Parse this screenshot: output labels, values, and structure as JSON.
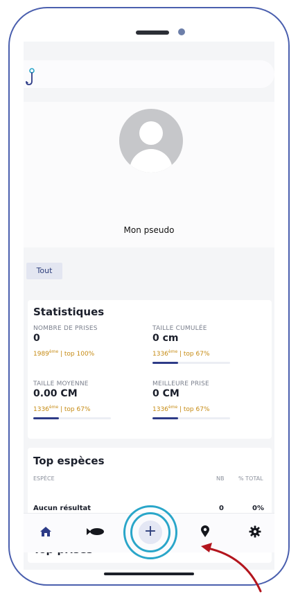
{
  "profile": {
    "pseudo": "Mon pseudo"
  },
  "filter": {
    "label": "Tout"
  },
  "statistics": {
    "title": "Statistiques",
    "items": [
      {
        "label": "NOMBRE DE PRISES",
        "value": "0",
        "rank_num": "1989",
        "rank_sup": "ème",
        "rank_rest": " | top 100%",
        "progress": 0.0
      },
      {
        "label": "TAILLE CUMULÉE",
        "value": "0 cm",
        "rank_num": "1336",
        "rank_sup": "ème",
        "rank_rest": " | top 67%",
        "progress": 0.33
      },
      {
        "label": "TAILLE MOYENNE",
        "value": "0.00 CM",
        "rank_num": "1336",
        "rank_sup": "ème",
        "rank_rest": " | top 67%",
        "progress": 0.33
      },
      {
        "label": "MEILLEURE PRISE",
        "value": "0 CM",
        "rank_num": "1336",
        "rank_sup": "ème",
        "rank_rest": " | top 67%",
        "progress": 0.33
      }
    ]
  },
  "top_species": {
    "title": "Top espèces",
    "headers": {
      "species": "ESPÈCE",
      "nb": "NB",
      "total": "% TOTAL"
    },
    "row": {
      "species": "Aucun résultat",
      "nb": "0",
      "total": "0%"
    }
  },
  "top_prises": {
    "title": "Top prises"
  },
  "nav": {
    "items": [
      {
        "name": "home-icon"
      },
      {
        "name": "fish-icon"
      },
      {
        "name": "add-icon",
        "label": "+"
      },
      {
        "name": "map-pin-icon"
      },
      {
        "name": "gear-icon"
      }
    ]
  },
  "colors": {
    "accent": "#2d3b87",
    "rank": "#c58a12",
    "highlight": "#2aa6c9",
    "annotation_arrow": "#b3151d"
  }
}
